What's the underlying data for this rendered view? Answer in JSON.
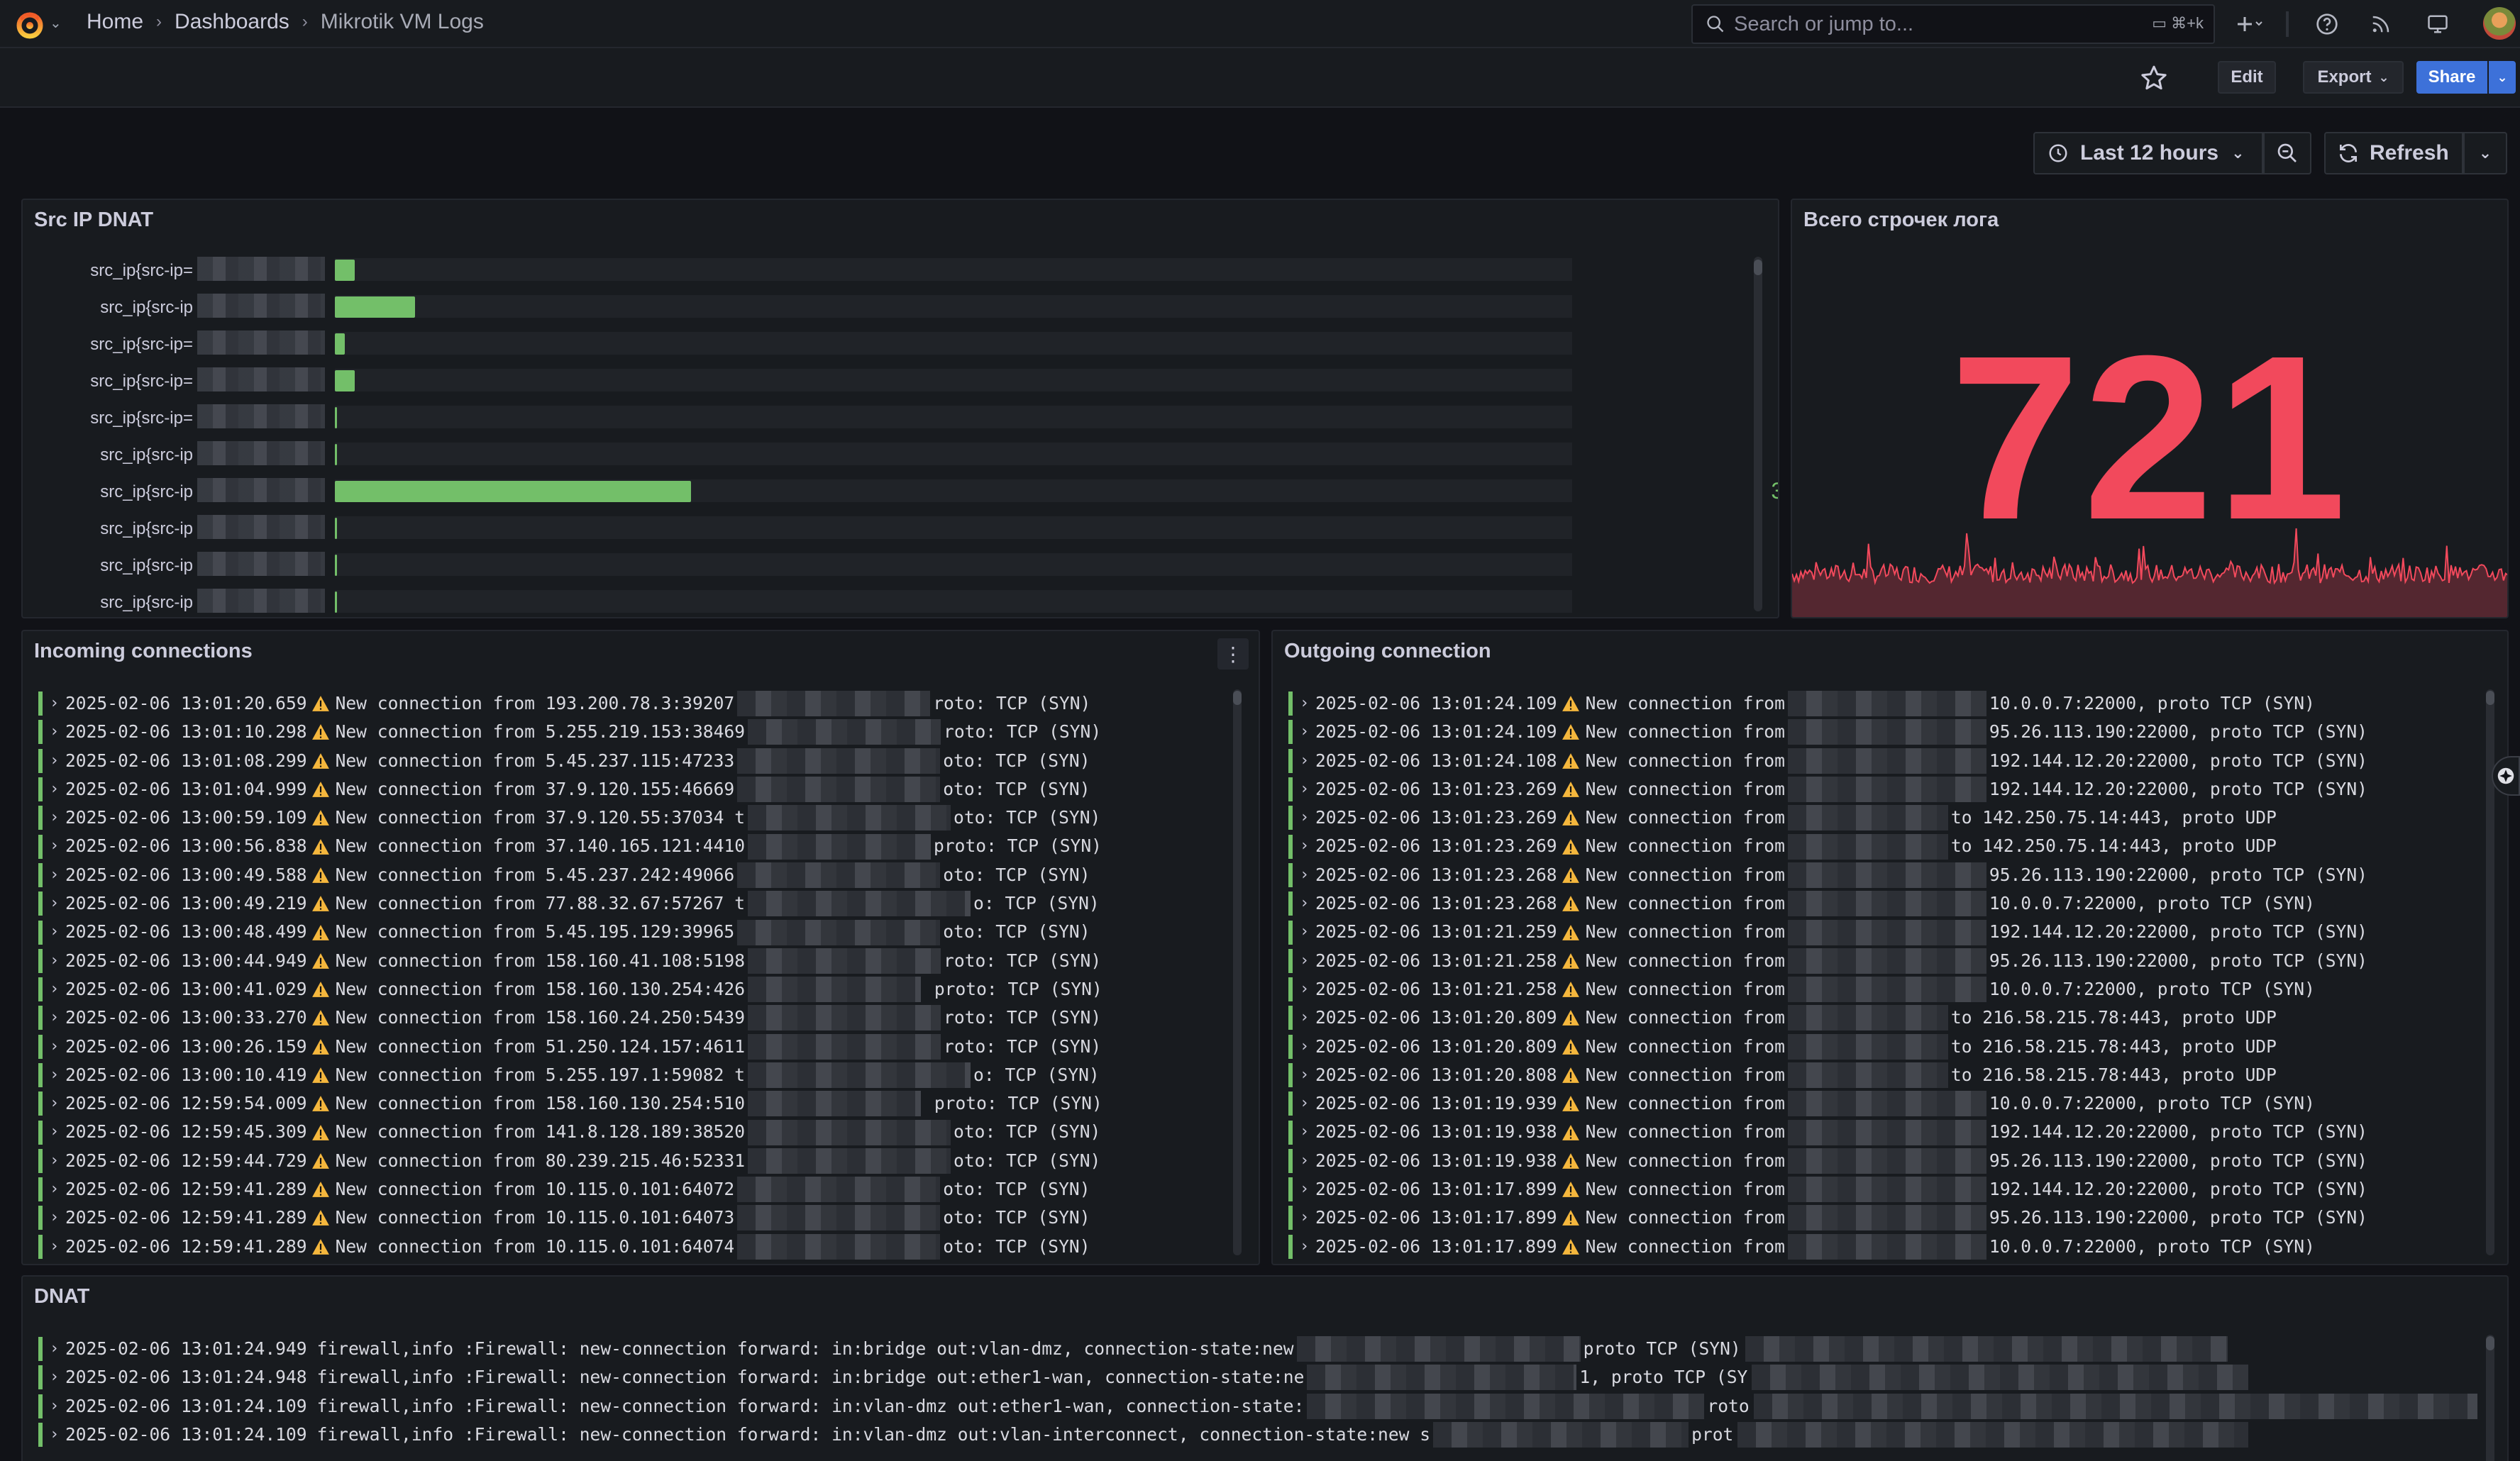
{
  "breadcrumb": [
    "Home",
    "Dashboards",
    "Mikrotik VM Logs"
  ],
  "search": {
    "placeholder": "Search or jump to...",
    "shortcut": "⌘+k"
  },
  "toolbar": {
    "edit": "Edit",
    "export": "Export",
    "share": "Share"
  },
  "time": {
    "range": "Last 12 hours",
    "refresh": "Refresh"
  },
  "panels": {
    "src_ip": {
      "title": "Src IP DNAT",
      "rows": [
        {
          "label": "src_ip{src-ip=",
          "fill": 0.016,
          "value": "3"
        },
        {
          "label": "src_ip{src-ip",
          "fill": 0.065,
          "value": "9"
        },
        {
          "label": "src_ip{src-ip=",
          "fill": 0.008,
          "value": "2"
        },
        {
          "label": "src_ip{src-ip=",
          "fill": 0.016,
          "value": "3"
        },
        {
          "label": "src_ip{src-ip=",
          "fill": 0.002,
          "value": "1"
        },
        {
          "label": "src_ip{src-ip",
          "fill": 0.002,
          "value": "1"
        },
        {
          "label": "src_ip{src-ip",
          "fill": 0.288,
          "value": "36"
        },
        {
          "label": "src_ip{src-ip",
          "fill": 0.002,
          "value": "1"
        },
        {
          "label": "src_ip{src-ip",
          "fill": 0.002,
          "value": "1"
        },
        {
          "label": "src_ip{src-ip",
          "fill": 0.002,
          "value": "1"
        }
      ]
    },
    "total": {
      "title": "Всего строчек лога",
      "value": "721"
    },
    "incoming": {
      "title": "Incoming connections",
      "lines": [
        {
          "ts": "2025-02-06 13:01:20.659",
          "pre": "New connection from 193.200.78.3:39207",
          "post": "roto: TCP (SYN)"
        },
        {
          "ts": "2025-02-06 13:01:10.298",
          "pre": "New connection from 5.255.219.153:38469",
          "post": "roto: TCP (SYN)"
        },
        {
          "ts": "2025-02-06 13:01:08.299",
          "pre": "New connection from 5.45.237.115:47233",
          "post": "oto: TCP (SYN)"
        },
        {
          "ts": "2025-02-06 13:01:04.999",
          "pre": "New connection from 37.9.120.155:46669",
          "post": "oto: TCP (SYN)"
        },
        {
          "ts": "2025-02-06 13:00:59.109",
          "pre": "New connection from 37.9.120.55:37034 t",
          "post": "oto: TCP (SYN)"
        },
        {
          "ts": "2025-02-06 13:00:56.838",
          "pre": "New connection from 37.140.165.121:4410",
          "post": "proto: TCP (SYN)"
        },
        {
          "ts": "2025-02-06 13:00:49.588",
          "pre": "New connection from 5.45.237.242:49066",
          "post": "oto: TCP (SYN)"
        },
        {
          "ts": "2025-02-06 13:00:49.219",
          "pre": "New connection from 77.88.32.67:57267 t",
          "post": "o: TCP (SYN)"
        },
        {
          "ts": "2025-02-06 13:00:48.499",
          "pre": "New connection from 5.45.195.129:39965",
          "post": "oto: TCP (SYN)"
        },
        {
          "ts": "2025-02-06 13:00:44.949",
          "pre": "New connection from 158.160.41.108:5198",
          "post": "roto: TCP (SYN)"
        },
        {
          "ts": "2025-02-06 13:00:41.029",
          "pre": "New connection from 158.160.130.254:426",
          "post": " proto: TCP (SYN)"
        },
        {
          "ts": "2025-02-06 13:00:33.270",
          "pre": "New connection from 158.160.24.250:5439",
          "post": "roto: TCP (SYN)"
        },
        {
          "ts": "2025-02-06 13:00:26.159",
          "pre": "New connection from 51.250.124.157:4611",
          "post": "roto: TCP (SYN)"
        },
        {
          "ts": "2025-02-06 13:00:10.419",
          "pre": "New connection from 5.255.197.1:59082 t",
          "post": "o: TCP (SYN)"
        },
        {
          "ts": "2025-02-06 12:59:54.009",
          "pre": "New connection from 158.160.130.254:510",
          "post": " proto: TCP (SYN)"
        },
        {
          "ts": "2025-02-06 12:59:45.309",
          "pre": "New connection from 141.8.128.189:38520",
          "post": "oto: TCP (SYN)"
        },
        {
          "ts": "2025-02-06 12:59:44.729",
          "pre": "New connection from 80.239.215.46:52331",
          "post": "oto: TCP (SYN)"
        },
        {
          "ts": "2025-02-06 12:59:41.289",
          "pre": "New connection from 10.115.0.101:64072",
          "post": "oto: TCP (SYN)"
        },
        {
          "ts": "2025-02-06 12:59:41.289",
          "pre": "New connection from 10.115.0.101:64073",
          "post": "oto: TCP (SYN)"
        },
        {
          "ts": "2025-02-06 12:59:41.289",
          "pre": "New connection from 10.115.0.101:64074",
          "post": "oto: TCP (SYN)"
        }
      ]
    },
    "outgoing": {
      "title": "Outgoing connection",
      "lines": [
        {
          "ts": "2025-02-06 13:01:24.109",
          "pre": "New connection from",
          "post": "10.0.0.7:22000, proto TCP (SYN)"
        },
        {
          "ts": "2025-02-06 13:01:24.109",
          "pre": "New connection from",
          "post": "95.26.113.190:22000, proto TCP (SYN)"
        },
        {
          "ts": "2025-02-06 13:01:24.108",
          "pre": "New connection from",
          "post": "192.144.12.20:22000, proto TCP (SYN)"
        },
        {
          "ts": "2025-02-06 13:01:23.269",
          "pre": "New connection from",
          "post": "192.144.12.20:22000, proto TCP (SYN)"
        },
        {
          "ts": "2025-02-06 13:01:23.269",
          "pre": "New connection from",
          "post": "to 142.250.75.14:443, proto UDP"
        },
        {
          "ts": "2025-02-06 13:01:23.269",
          "pre": "New connection from",
          "post": "to 142.250.75.14:443, proto UDP"
        },
        {
          "ts": "2025-02-06 13:01:23.268",
          "pre": "New connection from",
          "post": "95.26.113.190:22000, proto TCP (SYN)"
        },
        {
          "ts": "2025-02-06 13:01:23.268",
          "pre": "New connection from",
          "post": "10.0.0.7:22000, proto TCP (SYN)"
        },
        {
          "ts": "2025-02-06 13:01:21.259",
          "pre": "New connection from",
          "post": "192.144.12.20:22000, proto TCP (SYN)"
        },
        {
          "ts": "2025-02-06 13:01:21.258",
          "pre": "New connection from",
          "post": "95.26.113.190:22000, proto TCP (SYN)"
        },
        {
          "ts": "2025-02-06 13:01:21.258",
          "pre": "New connection from",
          "post": "10.0.0.7:22000, proto TCP (SYN)"
        },
        {
          "ts": "2025-02-06 13:01:20.809",
          "pre": "New connection from",
          "post": "to 216.58.215.78:443, proto UDP"
        },
        {
          "ts": "2025-02-06 13:01:20.809",
          "pre": "New connection from",
          "post": "to 216.58.215.78:443, proto UDP"
        },
        {
          "ts": "2025-02-06 13:01:20.808",
          "pre": "New connection from",
          "post": "to 216.58.215.78:443, proto UDP"
        },
        {
          "ts": "2025-02-06 13:01:19.939",
          "pre": "New connection from",
          "post": "10.0.0.7:22000, proto TCP (SYN)"
        },
        {
          "ts": "2025-02-06 13:01:19.938",
          "pre": "New connection from",
          "post": "192.144.12.20:22000, proto TCP (SYN)"
        },
        {
          "ts": "2025-02-06 13:01:19.938",
          "pre": "New connection from",
          "post": "95.26.113.190:22000, proto TCP (SYN)"
        },
        {
          "ts": "2025-02-06 13:01:17.899",
          "pre": "New connection from",
          "post": "192.144.12.20:22000, proto TCP (SYN)"
        },
        {
          "ts": "2025-02-06 13:01:17.899",
          "pre": "New connection from",
          "post": "95.26.113.190:22000, proto TCP (SYN)"
        },
        {
          "ts": "2025-02-06 13:01:17.899",
          "pre": "New connection from",
          "post": "10.0.0.7:22000, proto TCP (SYN)"
        }
      ]
    },
    "dnat": {
      "title": "DNAT",
      "lines": [
        {
          "ts": "2025-02-06 13:01:24.949",
          "pre": "firewall,info :Firewall: new-connection forward: in:bridge out:vlan-dmz, connection-state:new",
          "post": "proto TCP (SYN)"
        },
        {
          "ts": "2025-02-06 13:01:24.948",
          "pre": "firewall,info :Firewall: new-connection forward: in:bridge out:ether1-wan, connection-state:ne",
          "post": "1, proto TCP (SY"
        },
        {
          "ts": "2025-02-06 13:01:24.109",
          "pre": "firewall,info :Firewall: new-connection forward: in:vlan-dmz out:ether1-wan, connection-state:",
          "post": "roto"
        },
        {
          "ts": "2025-02-06 13:01:24.109",
          "pre": "firewall,info :Firewall: new-connection forward: in:vlan-dmz out:vlan-interconnect, connection-state:new s",
          "post": "prot"
        }
      ]
    }
  },
  "colors": {
    "bar": "#73bf69",
    "stat": "#f2495c",
    "accent": "#3d71d9",
    "warn": "#f5b73d"
  }
}
